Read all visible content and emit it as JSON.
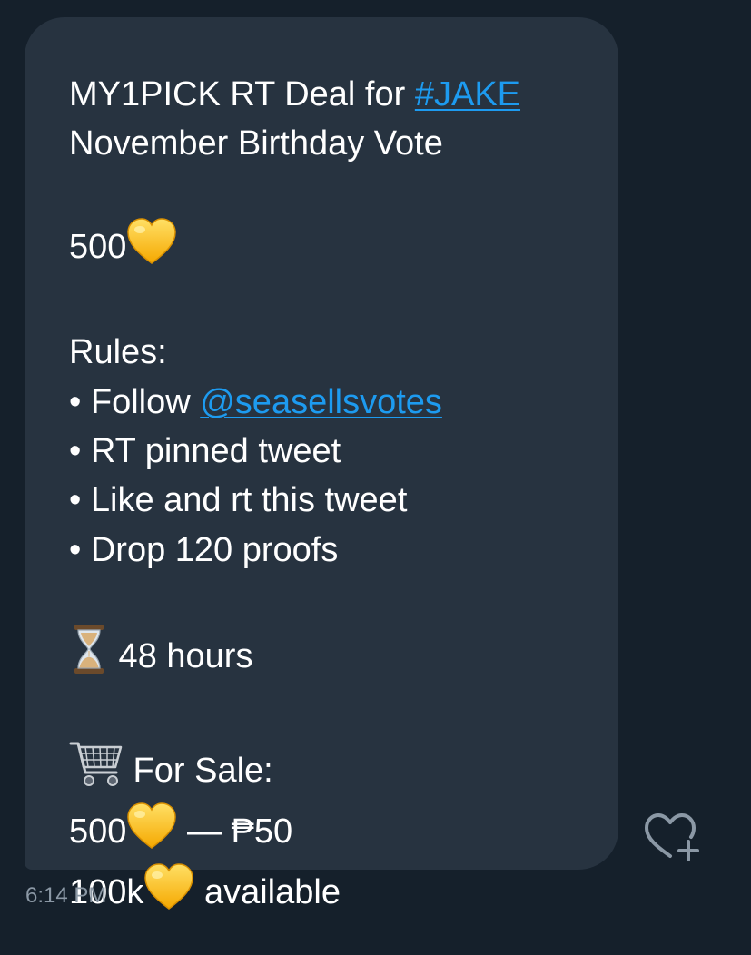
{
  "message": {
    "title_prefix": "MY1PICK RT Deal for ",
    "hashtag": "#JAKE",
    "title_line2": "November Birthday Vote",
    "amount": "500",
    "rules_heading": "Rules:",
    "rule1_prefix": "• Follow ",
    "mention": "@seasellsvotes",
    "rule2": "• RT pinned tweet",
    "rule3": "• Like and rt this tweet",
    "rule4": "• Drop 120 proofs",
    "duration": " 48 hours",
    "sale_heading": " For Sale:",
    "sale_amount": "500",
    "sale_price": "  —  ₱50",
    "available_amount": "100k",
    "available_text": " available"
  },
  "timestamp": "6:14 PM",
  "colors": {
    "background": "#15202b",
    "bubble": "#273340",
    "link": "#1d9bf0",
    "timestamp": "#8b98a5"
  },
  "icons": {
    "emoji": [
      "yellow-heart-icon",
      "hourglass-icon",
      "shopping-cart-icon"
    ],
    "reaction": "heart-plus-icon"
  }
}
